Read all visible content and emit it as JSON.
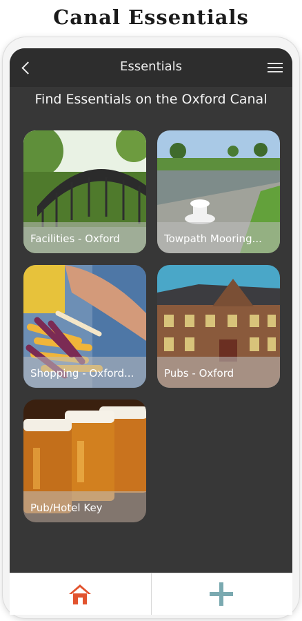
{
  "headline": "Canal Essentials",
  "appbar": {
    "title": "Essentials",
    "back_icon": "chevron-left-icon",
    "menu_icon": "hamburger-menu-icon"
  },
  "subtitle": "Find Essentials on the Oxford Canal",
  "tiles": [
    {
      "label": "Facilities - Oxford",
      "image": "canal-bridge-photo"
    },
    {
      "label": "Towpath Mooring...",
      "image": "towpath-mooring-bollard-photo"
    },
    {
      "label": "Shopping - Oxford...",
      "image": "market-vegetables-photo"
    },
    {
      "label": "Pubs - Oxford",
      "image": "pub-building-photo"
    },
    {
      "label": "Pub/Hotel Key",
      "image": "beer-glasses-photo"
    }
  ],
  "bottom_nav": {
    "home_icon": "home-icon",
    "add_icon": "plus-icon"
  },
  "colors": {
    "screen_bg": "#373737",
    "appbar_bg": "#2d2d2d",
    "home_icon": "#e2532e",
    "add_icon": "#7aa9b0"
  }
}
